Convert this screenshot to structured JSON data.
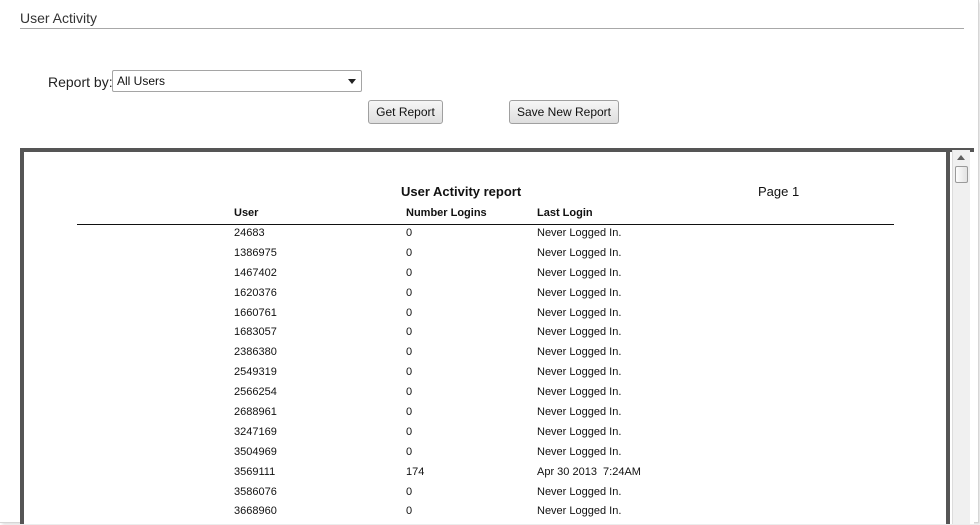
{
  "header": {
    "title": "User Activity"
  },
  "filters": {
    "report_by_label": "Report by:",
    "report_by_value": "All Users"
  },
  "actions": {
    "get_report_label": "Get Report",
    "save_new_report_label": "Save New Report"
  },
  "report": {
    "title": "User Activity report",
    "page_label": "Page 1",
    "columns": {
      "user": "User",
      "number_logins": "Number Logins",
      "last_login": "Last Login"
    },
    "rows": [
      {
        "user": "24683",
        "logins": "0",
        "last_login": "Never Logged In."
      },
      {
        "user": "1386975",
        "logins": "0",
        "last_login": "Never Logged In."
      },
      {
        "user": "1467402",
        "logins": "0",
        "last_login": "Never Logged In."
      },
      {
        "user": "1620376",
        "logins": "0",
        "last_login": "Never Logged In."
      },
      {
        "user": "1660761",
        "logins": "0",
        "last_login": "Never Logged In."
      },
      {
        "user": "1683057",
        "logins": "0",
        "last_login": "Never Logged In."
      },
      {
        "user": "2386380",
        "logins": "0",
        "last_login": "Never Logged In."
      },
      {
        "user": "2549319",
        "logins": "0",
        "last_login": "Never Logged In."
      },
      {
        "user": "2566254",
        "logins": "0",
        "last_login": "Never Logged In."
      },
      {
        "user": "2688961",
        "logins": "0",
        "last_login": "Never Logged In."
      },
      {
        "user": "3247169",
        "logins": "0",
        "last_login": "Never Logged In."
      },
      {
        "user": "3504969",
        "logins": "0",
        "last_login": "Never Logged In."
      },
      {
        "user": "3569111",
        "logins": "174",
        "last_login": "Apr 30 2013  7:24AM"
      },
      {
        "user": "3586076",
        "logins": "0",
        "last_login": "Never Logged In."
      },
      {
        "user": "3668960",
        "logins": "0",
        "last_login": "Never Logged In."
      }
    ]
  }
}
